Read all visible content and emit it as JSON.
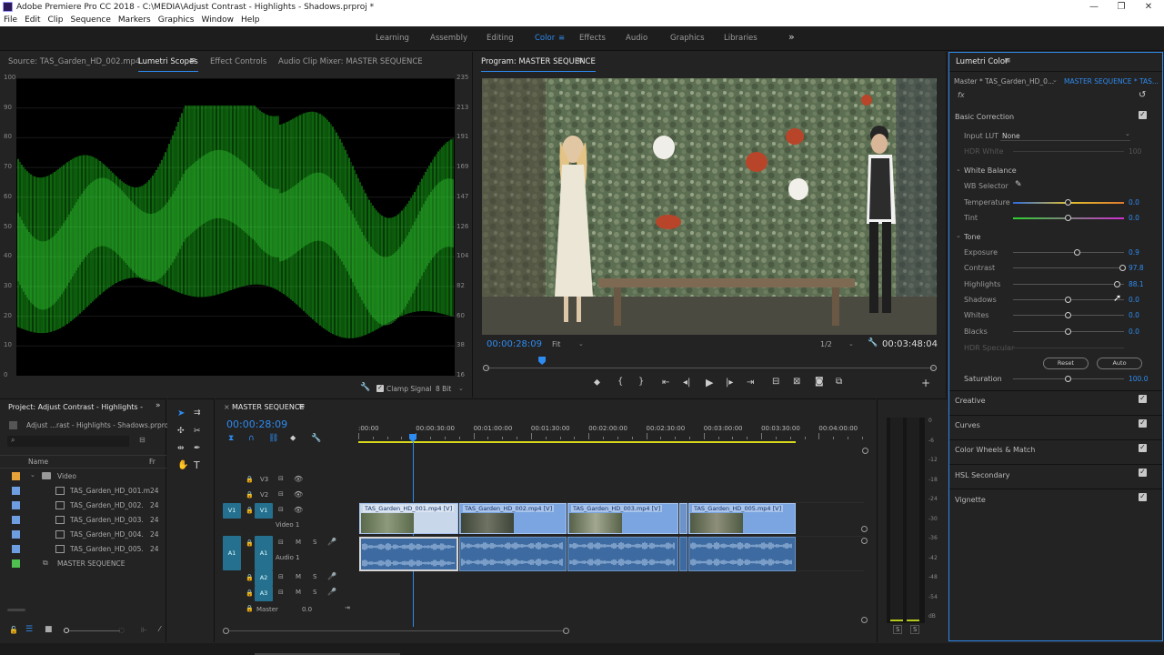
{
  "window": {
    "title": "Adobe Premiere Pro CC 2018 - C:\\MEDIA\\Adjust Contrast - Highlights - Shadows.prproj *",
    "controls": {
      "minimize": "—",
      "maximize": "❐",
      "close": "✕"
    }
  },
  "menu": [
    "File",
    "Edit",
    "Clip",
    "Sequence",
    "Markers",
    "Graphics",
    "Window",
    "Help"
  ],
  "workspaces": {
    "items": [
      "Learning",
      "Assembly",
      "Editing",
      "Color",
      "Effects",
      "Audio",
      "Graphics",
      "Libraries"
    ],
    "active": "Color",
    "hamburger": "≡",
    "more": "»"
  },
  "source_panel": {
    "tabs": [
      "Source: TAS_Garden_HD_002.mp4",
      "Lumetri Scopes",
      "Effect Controls",
      "Audio Clip Mixer: MASTER SEQUENCE"
    ],
    "active_tab": "Lumetri Scopes",
    "scope": {
      "left_axis": [
        "100",
        "90",
        "80",
        "70",
        "60",
        "50",
        "40",
        "30",
        "20",
        "10",
        "0"
      ],
      "right_axis": [
        "235",
        "213",
        "191",
        "169",
        "147",
        "126",
        "104",
        "82",
        "60",
        "38",
        "16"
      ],
      "clamp_signal_label": "Clamp Signal",
      "clamp_signal_checked": true,
      "bit_depth": "8 Bit",
      "waveform_color": "#1fd41f"
    }
  },
  "program_monitor": {
    "title": "Program: MASTER SEQUENCE",
    "current_time": "00:00:28:09",
    "fit": "Fit",
    "resolution": "1/2",
    "duration": "00:03:48:04",
    "playhead_fraction": 0.126
  },
  "lumetri": {
    "title": "Lumetri Color",
    "master_clip": "Master * TAS_Garden_HD_0...",
    "sequence_clip": "MASTER SEQUENCE * TAS...",
    "fx": "fx",
    "basic_correction": "Basic Correction",
    "input_lut_label": "Input LUT",
    "input_lut_value": "None",
    "hdr_white": "HDR White",
    "hdr_white_value": "100",
    "white_balance": "White Balance",
    "wb_selector": "WB Selector",
    "wb_controls": [
      {
        "label": "Temperature",
        "value": "0.0",
        "fraction": 0.5
      },
      {
        "label": "Tint",
        "value": "0.0",
        "fraction": 0.5
      }
    ],
    "tone": "Tone",
    "tone_controls": [
      {
        "label": "Exposure",
        "value": "0.9",
        "fraction": 0.58
      },
      {
        "label": "Contrast",
        "value": "97.8",
        "fraction": 0.99
      },
      {
        "label": "Highlights",
        "value": "88.1",
        "fraction": 0.94
      },
      {
        "label": "Shadows",
        "value": "0.0",
        "fraction": 0.5
      },
      {
        "label": "Whites",
        "value": "0.0",
        "fraction": 0.5
      },
      {
        "label": "Blacks",
        "value": "0.0",
        "fraction": 0.5
      }
    ],
    "hdr_specular": "HDR Specular",
    "reset": "Reset",
    "auto": "Auto",
    "saturation_label": "Saturation",
    "saturation_value": "100.0",
    "saturation_fraction": 0.5,
    "sections": [
      "Creative",
      "Curves",
      "Color Wheels & Match",
      "HSL Secondary",
      "Vignette"
    ]
  },
  "project": {
    "title": "Project: Adjust Contrast - Highlights - Shado",
    "file": "Adjust ...rast - Highlights - Shadows.prproj",
    "col_name": "Name",
    "col_fr": "Fr",
    "rows": [
      {
        "name": "Video",
        "fr": "",
        "color": "#e8a23a",
        "kind": "folder"
      },
      {
        "name": "TAS_Garden_HD_001.m",
        "fr": "24",
        "color": "#6f9ee0",
        "kind": "clip"
      },
      {
        "name": "TAS_Garden_HD_002.",
        "fr": "24",
        "color": "#6f9ee0",
        "kind": "clip"
      },
      {
        "name": "TAS_Garden_HD_003.",
        "fr": "24",
        "color": "#6f9ee0",
        "kind": "clip"
      },
      {
        "name": "TAS_Garden_HD_004.",
        "fr": "24",
        "color": "#6f9ee0",
        "kind": "clip"
      },
      {
        "name": "TAS_Garden_HD_005.",
        "fr": "24",
        "color": "#6f9ee0",
        "kind": "clip"
      },
      {
        "name": "MASTER SEQUENCE",
        "fr": "",
        "color": "#4fbf4f",
        "kind": "sequence"
      }
    ]
  },
  "timeline": {
    "title": "MASTER SEQUENCE",
    "timecode": "00:00:28:09",
    "ruler": [
      ":00:00",
      "00:00:30:00",
      "00:01:00:00",
      "00:01:30:00",
      "00:02:00:00",
      "00:02:30:00",
      "00:03:00:00",
      "00:03:30:00",
      "00:04:00:00"
    ],
    "tracks": {
      "v3": "V3",
      "v2": "V2",
      "v1": "V1",
      "v1_src": "V1",
      "video1": "Video 1",
      "a1": "A1",
      "a1_src": "A1",
      "audio1": "Audio 1",
      "a2": "A2",
      "a3": "A3",
      "master": "Master",
      "master_val": "0.0",
      "m": "M",
      "s": "S"
    },
    "clips": [
      {
        "label": "TAS_Garden_HD_001.mp4 [V]"
      },
      {
        "label": "TAS_Garden_HD_002.mp4 [V]"
      },
      {
        "label": "TAS_Garden_HD_003.mp4 [V]"
      },
      {
        "label": "TAS_Garden_HD_005.mp4 [V]"
      }
    ]
  },
  "meters": {
    "scale": [
      "0",
      "-6",
      "-12",
      "-18",
      "-24",
      "-30",
      "-36",
      "-42",
      "-48",
      "-54",
      "dB"
    ],
    "solo": [
      "S",
      "S"
    ]
  },
  "colors": {
    "accent": "#2e8bf0",
    "panel_bg": "#232323",
    "clip_video": "#7aa5e0",
    "clip_audio": "#3d6aa0",
    "track_badge": "#26708f"
  }
}
